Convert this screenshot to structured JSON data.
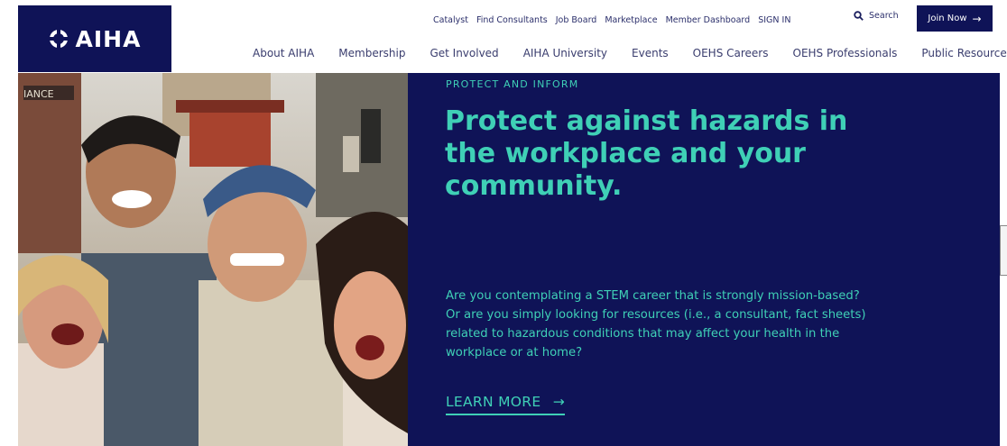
{
  "brand": {
    "name": "AIHA",
    "logo_icon": "aiha-logo-mark",
    "color": "#0f1357",
    "accent": "#3fd0b6"
  },
  "utility_nav": {
    "links": [
      "Catalyst",
      "Find Consultants",
      "Job Board",
      "Marketplace",
      "Member Dashboard",
      "SIGN IN"
    ],
    "search_label": "Search",
    "search_icon": "search-icon",
    "join_label": "Join Now",
    "join_arrow": "→"
  },
  "main_nav": {
    "items": [
      "About AIHA",
      "Membership",
      "Get Involved",
      "AIHA University",
      "Events",
      "OEHS Careers",
      "OEHS Professionals",
      "Public Resources"
    ]
  },
  "hero": {
    "eyebrow": "PROTECT AND INFORM",
    "title": "Protect against hazards in the workplace and your community.",
    "body": "Are you contemplating a STEM career that is strongly mission-based? Or are you simply looking for resources (i.e., a consultant, fact sheets) related to hazardous conditions that may affect your health in the workplace or at home?",
    "cta_label": "LEARN MORE",
    "cta_arrow": "→",
    "photo_sign_text": "IANCE"
  }
}
